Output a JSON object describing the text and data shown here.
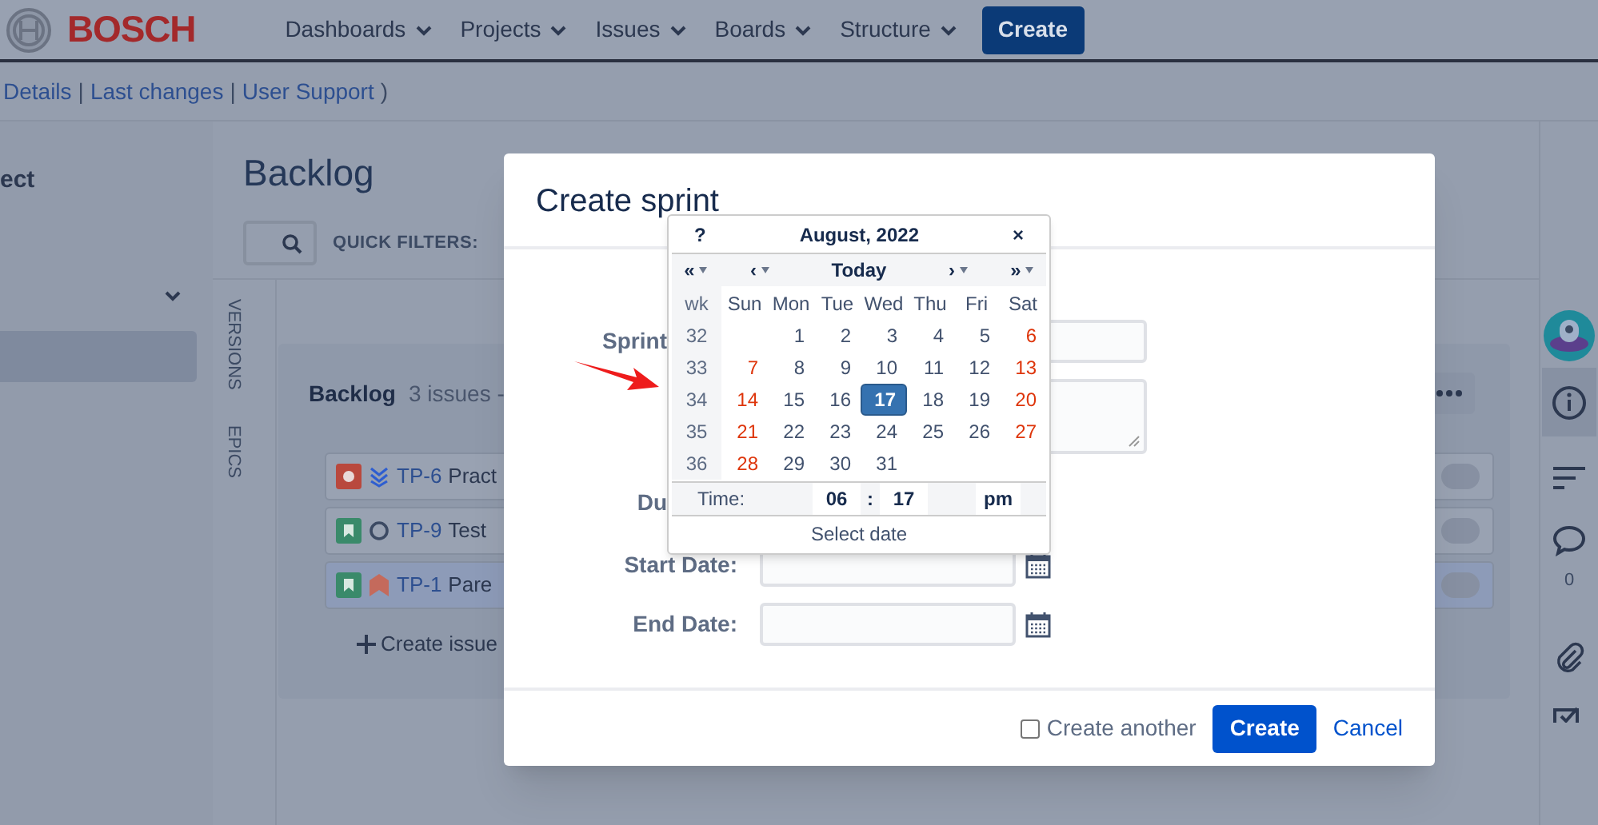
{
  "header": {
    "logo": "BOSCH",
    "nav": [
      {
        "label": "Dashboards"
      },
      {
        "label": "Projects"
      },
      {
        "label": "Issues"
      },
      {
        "label": "Boards"
      },
      {
        "label": "Structure"
      }
    ],
    "create": "Create"
  },
  "subnav": [
    {
      "kind": "link",
      "text": "Details"
    },
    {
      "kind": "text",
      "text": "|"
    },
    {
      "kind": "link",
      "text": "Last changes"
    },
    {
      "kind": "text",
      "text": "|"
    },
    {
      "kind": "link",
      "text": "User Support"
    },
    {
      "kind": "text",
      "text": ")"
    }
  ],
  "sidebar": {
    "title": "ect",
    "items": [
      {
        "selected": true
      }
    ]
  },
  "backlog_page": {
    "title": "Backlog",
    "quick_filters_label": "QUICK FILTERS:",
    "side_tabs": [
      "VERSIONS",
      "EPICS"
    ],
    "backlog": {
      "title": "Backlog",
      "count": "3 issues -",
      "create_issue": "Create issue",
      "issues": [
        {
          "icons": [
            {
              "kind": "bug"
            },
            {
              "kind": "lowest"
            }
          ],
          "key": "TP-6",
          "summary": "Pract",
          "selected": false
        },
        {
          "icons": [
            {
              "kind": "story"
            },
            {
              "kind": "unset"
            }
          ],
          "key": "TP-9",
          "summary": "Test",
          "selected": false
        },
        {
          "icons": [
            {
              "kind": "story"
            },
            {
              "kind": "highest"
            }
          ],
          "key": "TP-1",
          "summary": "Pare",
          "selected": true
        }
      ]
    }
  },
  "right_panel": {
    "items": [
      {
        "kind": "avatar",
        "selected": false
      },
      {
        "kind": "info",
        "selected": true
      },
      {
        "kind": "filter",
        "selected": false
      },
      {
        "kind": "comment",
        "selected": false
      },
      {
        "kind": "attachment",
        "selected": false
      },
      {
        "kind": "checklist",
        "selected": false
      }
    ],
    "comment_count": "0"
  },
  "dialog": {
    "title": "Create sprint",
    "fields": [
      {
        "label": "Sprint",
        "kind": "input"
      },
      {
        "kind": "textarea"
      },
      {
        "label": "Du",
        "kind": "blank"
      },
      {
        "label": "Start Date:",
        "kind": "date"
      },
      {
        "label": "End Date:",
        "kind": "date"
      }
    ],
    "create_another": {
      "label": "Create another",
      "checked": false
    },
    "create": "Create",
    "cancel": "Cancel"
  },
  "date_picker": {
    "help": "?",
    "title": "August, 2022",
    "close": "×",
    "nav": [
      {
        "label": "«",
        "menu": true
      },
      {
        "label": "‹",
        "menu": true
      },
      {
        "label": "Today",
        "menu": false
      },
      {
        "label": "›",
        "menu": true
      },
      {
        "label": "»",
        "menu": true
      }
    ],
    "week_label": "wk",
    "weekdays": [
      "Sun",
      "Mon",
      "Tue",
      "Wed",
      "Thu",
      "Fri",
      "Sat"
    ],
    "weeks": [
      {
        "number": "32",
        "days": [
          {
            "day": "1",
            "weekend": false,
            "selected": false
          },
          {
            "day": "2",
            "weekend": false,
            "selected": false
          },
          {
            "day": "3",
            "weekend": false,
            "selected": false
          },
          {
            "day": "4",
            "weekend": false,
            "selected": false
          },
          {
            "day": "5",
            "weekend": false,
            "selected": false
          },
          {
            "day": "6",
            "weekend": true,
            "selected": false
          }
        ]
      },
      {
        "number": "33",
        "days": [
          {
            "day": "7",
            "weekend": true,
            "selected": false
          },
          {
            "day": "8",
            "weekend": false,
            "selected": false
          },
          {
            "day": "9",
            "weekend": false,
            "selected": false
          },
          {
            "day": "10",
            "weekend": false,
            "selected": false
          },
          {
            "day": "11",
            "weekend": false,
            "selected": false
          },
          {
            "day": "12",
            "weekend": false,
            "selected": false
          },
          {
            "day": "13",
            "weekend": true,
            "selected": false
          }
        ]
      },
      {
        "number": "34",
        "days": [
          {
            "day": "14",
            "weekend": true,
            "selected": false
          },
          {
            "day": "15",
            "weekend": false,
            "selected": false
          },
          {
            "day": "16",
            "weekend": false,
            "selected": false
          },
          {
            "day": "17",
            "weekend": false,
            "selected": true
          },
          {
            "day": "18",
            "weekend": false,
            "selected": false
          },
          {
            "day": "19",
            "weekend": false,
            "selected": false
          },
          {
            "day": "20",
            "weekend": true,
            "selected": false
          }
        ]
      },
      {
        "number": "35",
        "days": [
          {
            "day": "21",
            "weekend": true,
            "selected": false
          },
          {
            "day": "22",
            "weekend": false,
            "selected": false
          },
          {
            "day": "23",
            "weekend": false,
            "selected": false
          },
          {
            "day": "24",
            "weekend": false,
            "selected": false
          },
          {
            "day": "25",
            "weekend": false,
            "selected": false
          },
          {
            "day": "26",
            "weekend": false,
            "selected": false
          },
          {
            "day": "27",
            "weekend": true,
            "selected": false
          }
        ]
      },
      {
        "number": "36",
        "days": [
          {
            "day": "28",
            "weekend": true,
            "selected": false
          },
          {
            "day": "29",
            "weekend": false,
            "selected": false
          },
          {
            "day": "30",
            "weekend": false,
            "selected": false
          },
          {
            "day": "31",
            "weekend": false,
            "selected": false
          }
        ]
      }
    ],
    "time": {
      "label": "Time:",
      "hour": "06",
      "separator": ":",
      "minute": "17",
      "ampm": "pm"
    },
    "footer": "Select date"
  }
}
